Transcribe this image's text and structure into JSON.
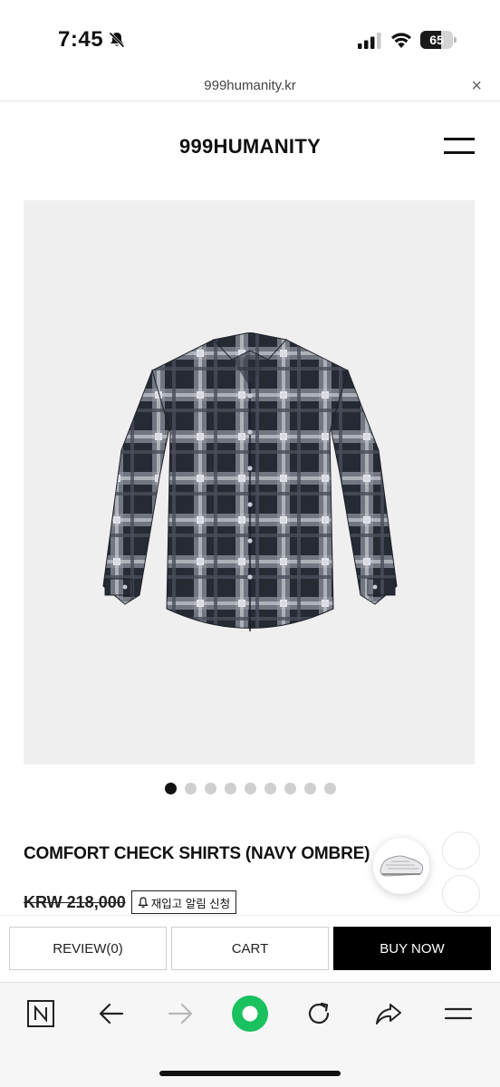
{
  "status_bar": {
    "time": "7:45",
    "battery": "65",
    "battery_level": 0.65
  },
  "browser": {
    "url": "999humanity.kr",
    "close_label": "×"
  },
  "site": {
    "logo": "999HUMANITY"
  },
  "gallery": {
    "image_count": 9,
    "active_index": 0
  },
  "product": {
    "title": "COMFORT CHECK SHIRTS (NAVY OMBRE)",
    "price_original": "KRW 218,000",
    "restock_label": "재입고 알림 신청"
  },
  "actions": {
    "review_label": "REVIEW(0)",
    "cart_label": "CART",
    "buy_label": "BUY NOW"
  },
  "toolbar": {
    "icons": [
      "naver-n-icon",
      "back-arrow-icon",
      "forward-arrow-icon",
      "green-home-icon",
      "reload-icon",
      "share-icon",
      "menu-icon"
    ]
  },
  "colors": {
    "accent_green": "#19c15f",
    "buy_button": "#000000",
    "image_bg": "#efefef"
  }
}
